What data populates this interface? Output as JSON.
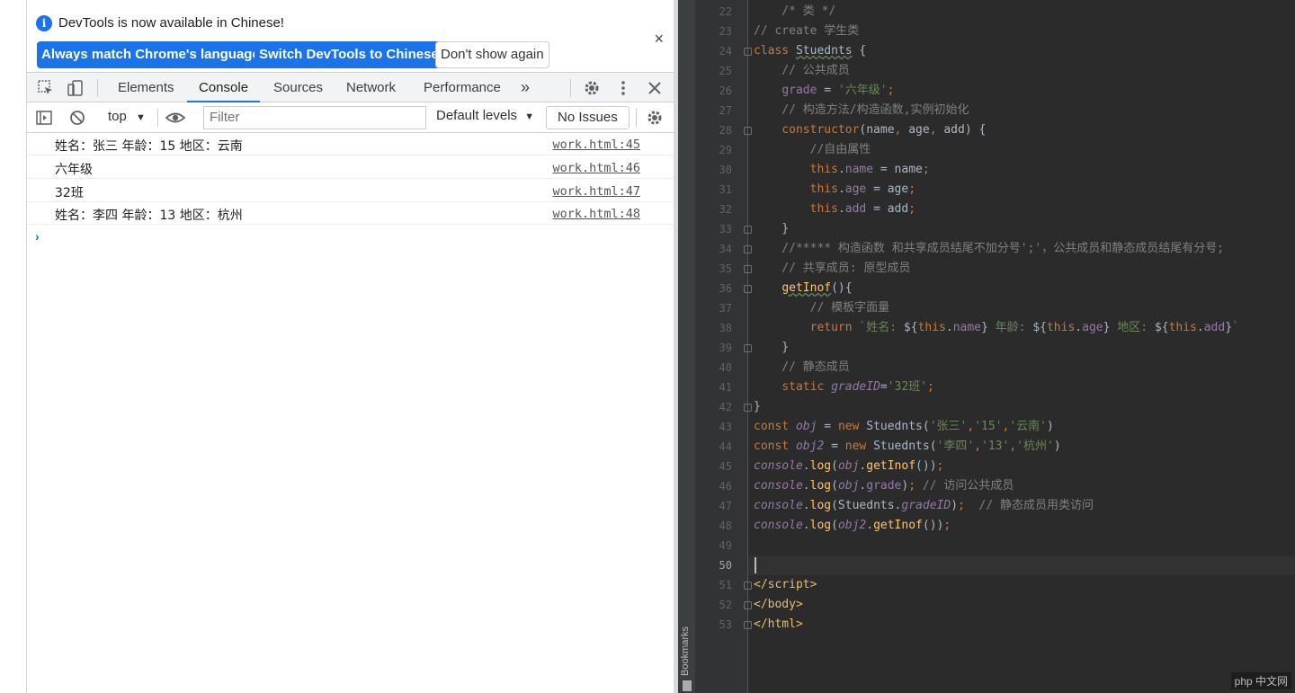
{
  "devtools": {
    "infobar": {
      "message": "DevTools is now available in Chinese!",
      "btn_match": "Always match Chrome's language",
      "btn_switch": "Switch DevTools to Chinese",
      "btn_dismiss": "Don't show again",
      "close_glyph": "×"
    },
    "tabs": [
      "Elements",
      "Console",
      "Sources",
      "Network",
      "Performance"
    ],
    "active_tab": "Console",
    "more_tabs_glyph": "»",
    "toolbar": {
      "context": "top",
      "filter_placeholder": "Filter",
      "levels": "Default levels",
      "issues": "No Issues"
    },
    "messages": [
      {
        "text": "姓名：张三 年龄：15 地区：云南",
        "source": "work.html:45"
      },
      {
        "text": "六年级",
        "source": "work.html:46"
      },
      {
        "text": "32班",
        "source": "work.html:47"
      },
      {
        "text": "姓名：李四 年龄：13 地区：杭州",
        "source": "work.html:48"
      }
    ],
    "prompt_glyph": "›",
    "colors": {
      "accent": "#1a73e8"
    }
  },
  "editor": {
    "line_numbers": [
      "22",
      "23",
      "24",
      "25",
      "26",
      "27",
      "28",
      "29",
      "30",
      "31",
      "32",
      "33",
      "34",
      "35",
      "36",
      "37",
      "38",
      "39",
      "40",
      "41",
      "42",
      "43",
      "44",
      "45",
      "46",
      "47",
      "48",
      "49",
      "50",
      "51",
      "52",
      "53"
    ],
    "current_line": "50",
    "bookmarks_label": "Bookmarks",
    "watermark": "php 中文网",
    "colors": {
      "background": "#2b2b2b",
      "keyword": "#cc7832",
      "string": "#6a8759",
      "comment": "#808080",
      "field": "#9876aa",
      "function": "#ffc66d"
    }
  }
}
